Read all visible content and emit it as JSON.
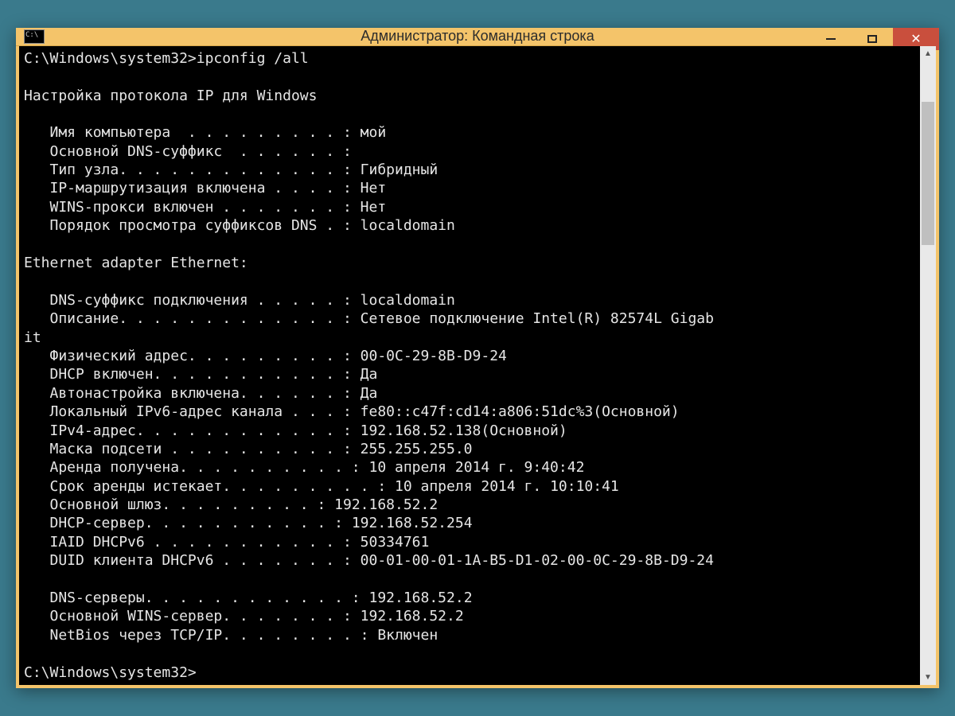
{
  "window": {
    "title": "Администратор: Командная строка"
  },
  "prompt1": "C:\\Windows\\system32>",
  "command": "ipconfig /all",
  "heading_winip": "Настройка протокола IP для Windows",
  "global": {
    "host_label": "   Имя компьютера  . . . . . . . . . : ",
    "host_value": "мой",
    "dns_suffix_label": "   Основной DNS-суффикс  . . . . . . : ",
    "dns_suffix_value": "",
    "node_label": "   Тип узла. . . . . . . . . . . . . : ",
    "node_value": "Гибридный",
    "iprouting_label": "   IP-маршрутизация включена . . . . : ",
    "iprouting_value": "Нет",
    "wins_label": "   WINS-прокси включен . . . . . . . : ",
    "wins_value": "Нет",
    "search_label": "   Порядок просмотра суффиксов DNS . : ",
    "search_value": "localdomain"
  },
  "adapter_heading": "Ethernet adapter Ethernet:",
  "adapter": {
    "conn_dns_label": "   DNS-суффикс подключения . . . . . : ",
    "conn_dns_value": "localdomain",
    "desc_label": "   Описание. . . . . . . . . . . . . : ",
    "desc_value": "Сетевое подключение Intel(R) 82574L Gigab",
    "desc_wrap": "it",
    "phys_label": "   Физический адрес. . . . . . . . . : ",
    "phys_value": "00-0C-29-8B-D9-24",
    "dhcp_label": "   DHCP включен. . . . . . . . . . . : ",
    "dhcp_value": "Да",
    "auto_label": "   Автонастройка включена. . . . . . : ",
    "auto_value": "Да",
    "ipv6_label": "   Локальный IPv6-адрес канала . . . : ",
    "ipv6_value": "fe80::c47f:cd14:a806:51dc%3(Основной)",
    "ipv4_label": "   IPv4-адрес. . . . . . . . . . . . : ",
    "ipv4_value": "192.168.52.138(Основной)",
    "mask_label": "   Маска подсети . . . . . . . . . . : ",
    "mask_value": "255.255.255.0",
    "lease_obt_label": "   Аренда получена. . . . . . . . . . : ",
    "lease_obt_value": "10 апреля 2014 г. 9:40:42",
    "lease_exp_label": "   Срок аренды истекает. . . . . . . . . : ",
    "lease_exp_value": "10 апреля 2014 г. 10:10:41",
    "gw_label": "   Основной шлюз. . . . . . . . . : ",
    "gw_value": "192.168.52.2",
    "dhcpsrv_label": "   DHCP-сервер. . . . . . . . . . . : ",
    "dhcpsrv_value": "192.168.52.254",
    "iaid_label": "   IAID DHCPv6 . . . . . . . . . . . : ",
    "iaid_value": "50334761",
    "duid_label": "   DUID клиента DHCPv6 . . . . . . . : ",
    "duid_value": "00-01-00-01-1A-B5-D1-02-00-0C-29-8B-D9-24",
    "dns_label": "   DNS-серверы. . . . . . . . . . . . : ",
    "dns_value": "192.168.52.2",
    "winssrv_label": "   Основной WINS-сервер. . . . . . . : ",
    "winssrv_value": "192.168.52.2",
    "netbios_label": "   NetBios через TCP/IP. . . . . . . . : ",
    "netbios_value": "Включен"
  },
  "prompt2": "C:\\Windows\\system32>"
}
